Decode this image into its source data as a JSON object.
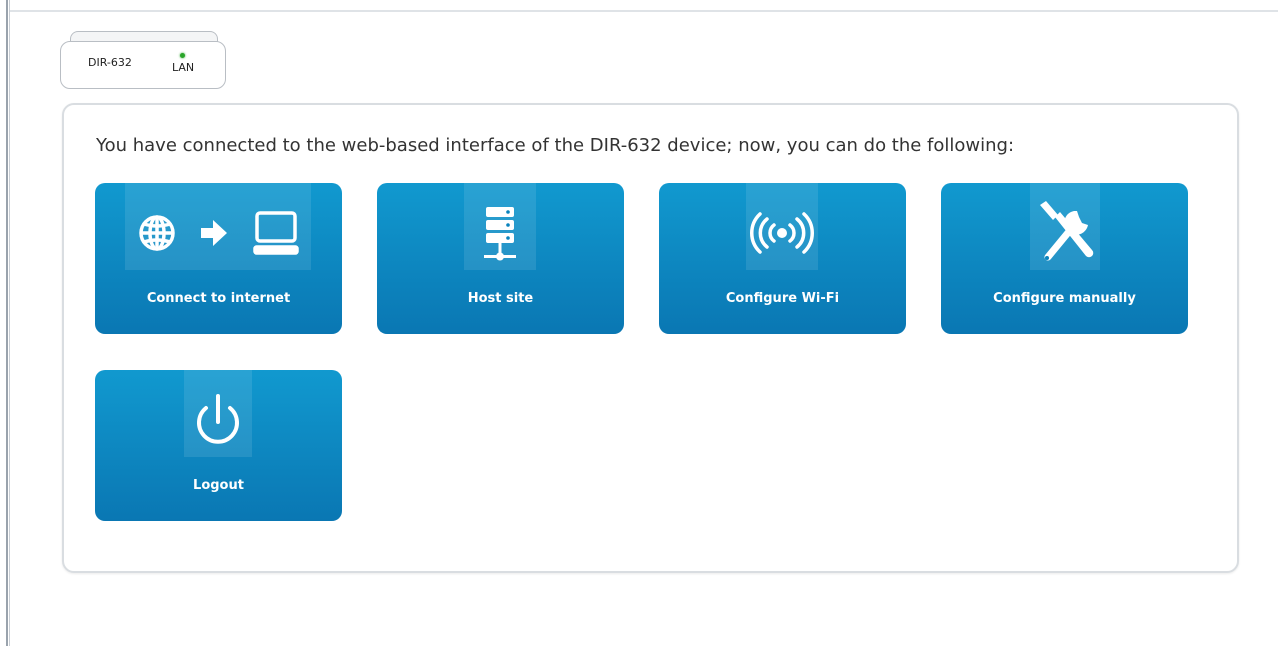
{
  "device": {
    "name": "DIR-632",
    "port_label": "LAN",
    "led_color": "#2aa52a"
  },
  "intro_text": "You have connected to the web-based interface of the DIR-632 device; now, you can do the following:",
  "colors": {
    "tile_top": "#1199cf",
    "tile_bottom": "#0a77b3",
    "tile_text": "#ffffff"
  },
  "tiles": [
    {
      "label": "Connect to internet",
      "icon": "globe-arrow-computer-icon"
    },
    {
      "label": "Host site",
      "icon": "server-icon"
    },
    {
      "label": "Configure Wi-Fi",
      "icon": "wifi-signal-icon"
    },
    {
      "label": "Configure manually",
      "icon": "tools-icon"
    },
    {
      "label": "Logout",
      "icon": "power-icon"
    }
  ]
}
